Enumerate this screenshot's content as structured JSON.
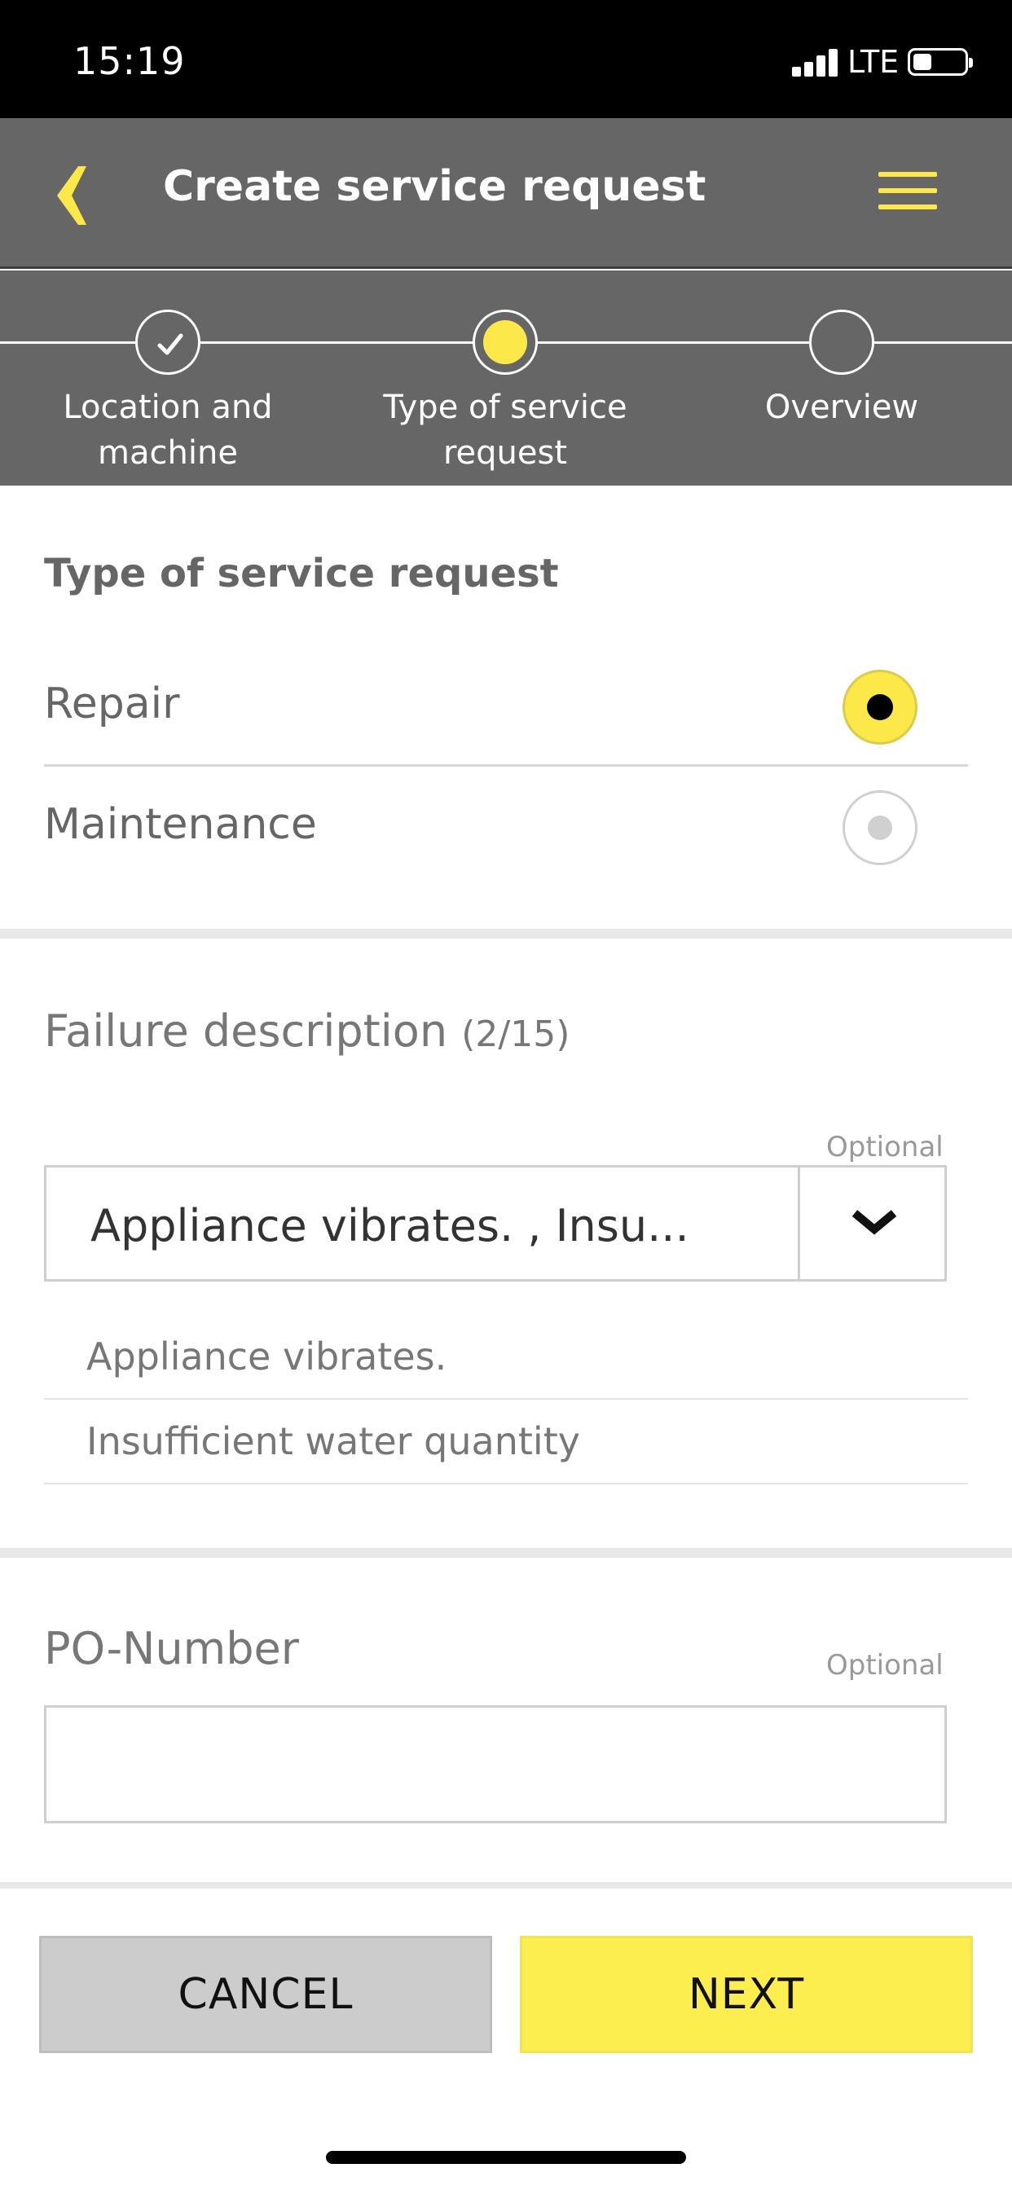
{
  "status_bar": {
    "time": "15:19",
    "network": "LTE"
  },
  "header": {
    "title": "Create service request",
    "back_icon": "chevron-left-icon",
    "menu_icon": "hamburger-menu-icon",
    "accent_color": "#fde84a"
  },
  "stepper": {
    "steps": [
      {
        "label_line1": "Location and",
        "label_line2": "machine",
        "state": "completed"
      },
      {
        "label_line1": "Type of service",
        "label_line2": "request",
        "state": "current"
      },
      {
        "label_line1": "Overview",
        "label_line2": "",
        "state": "upcoming"
      }
    ]
  },
  "service_type": {
    "title": "Type of service request",
    "options": [
      {
        "label": "Repair",
        "selected": true
      },
      {
        "label": "Maintenance",
        "selected": false
      }
    ]
  },
  "failure": {
    "title": "Failure description",
    "count": "(2/15)",
    "optional_label": "Optional",
    "selected_value": "Appliance vibrates. , Insu...",
    "items": [
      "Appliance vibrates.",
      "Insufficient water quantity"
    ]
  },
  "po_number": {
    "label": "PO-Number",
    "optional_label": "Optional",
    "value": ""
  },
  "actions": {
    "cancel_label": "CANCEL",
    "next_label": "NEXT"
  }
}
